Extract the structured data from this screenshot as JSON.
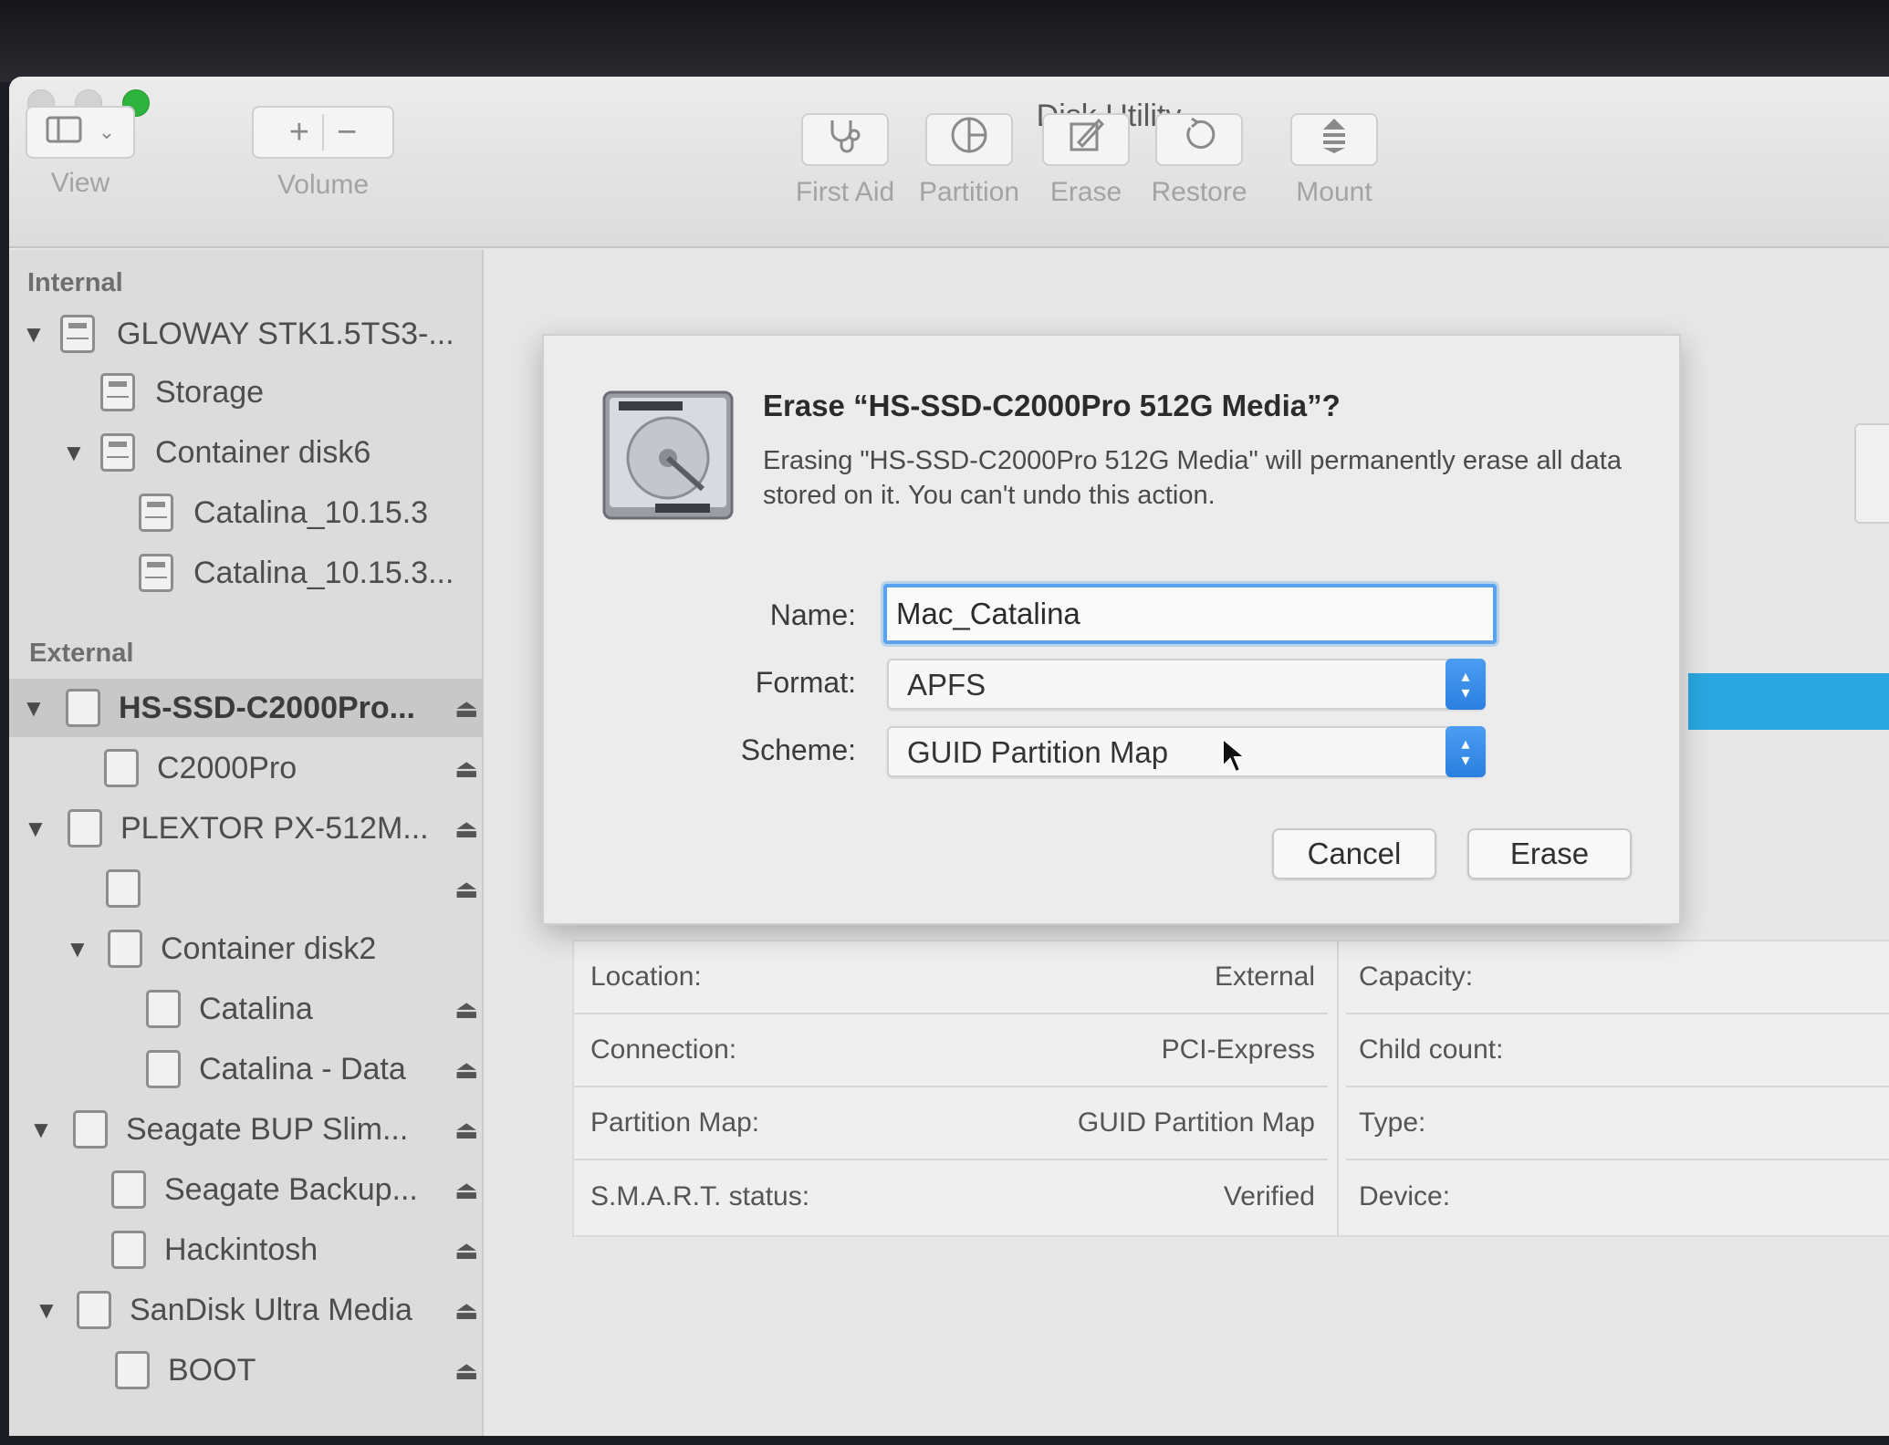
{
  "window": {
    "title": "Disk Utility"
  },
  "toolbar": {
    "view_label": "View",
    "volume_label": "Volume",
    "volume_add": "+",
    "volume_remove": "−",
    "first_aid_label": "First Aid",
    "partition_label": "Partition",
    "erase_label": "Erase",
    "restore_label": "Restore",
    "mount_label": "Mount"
  },
  "sidebar": {
    "internal_header": "Internal",
    "external_header": "External",
    "internal_items": [
      {
        "label": "GLOWAY STK1.5TS3-..."
      },
      {
        "label": "Storage"
      },
      {
        "label": "Container disk6"
      },
      {
        "label": "Catalina_10.15.3"
      },
      {
        "label": "Catalina_10.15.3..."
      }
    ],
    "external_items": [
      {
        "label": "HS-SSD-C2000Pro..."
      },
      {
        "label": "C2000Pro"
      },
      {
        "label": "PLEXTOR PX-512M..."
      },
      {
        "label": ""
      },
      {
        "label": "Container disk2"
      },
      {
        "label": "Catalina"
      },
      {
        "label": "Catalina - Data"
      },
      {
        "label": "Seagate BUP Slim..."
      },
      {
        "label": "Seagate Backup..."
      },
      {
        "label": "Hackintosh"
      },
      {
        "label": "SanDisk Ultra Media"
      },
      {
        "label": "BOOT"
      }
    ],
    "eject_glyph": "⏏",
    "disclosure_glyph": "▼"
  },
  "dialog": {
    "title": "Erase “HS-SSD-C2000Pro 512G Media”?",
    "message": "Erasing \"HS-SSD-C2000Pro 512G Media\" will permanently erase all data stored on it. You can't undo this action.",
    "name_label": "Name:",
    "name_value": "Mac_Catalina",
    "format_label": "Format:",
    "format_value": "APFS",
    "scheme_label": "Scheme:",
    "scheme_value": "GUID Partition Map",
    "cancel_label": "Cancel",
    "erase_label": "Erase"
  },
  "info": {
    "location_key": "Location:",
    "location_val": "External",
    "connection_key": "Connection:",
    "connection_val": "PCI-Express",
    "partition_map_key": "Partition Map:",
    "partition_map_val": "GUID Partition Map",
    "smart_key": "S.M.A.R.T. status:",
    "smart_val": "Verified",
    "capacity_key": "Capacity:",
    "child_count_key": "Child count:",
    "type_key": "Type:",
    "device_key": "Device:"
  },
  "colors": {
    "accent_blue": "#2aa7e0",
    "focus_ring": "#5aa2ee",
    "zoom_green": "#2fb33f"
  },
  "icons": {
    "view": "sidebar-toggle-icon",
    "first_aid": "stethoscope-icon",
    "partition": "pie-chart-icon",
    "erase": "eraser-icon",
    "restore": "restore-arrow-icon",
    "mount": "mount-icon",
    "drive": "hard-drive-icon",
    "eject": "eject-icon"
  }
}
